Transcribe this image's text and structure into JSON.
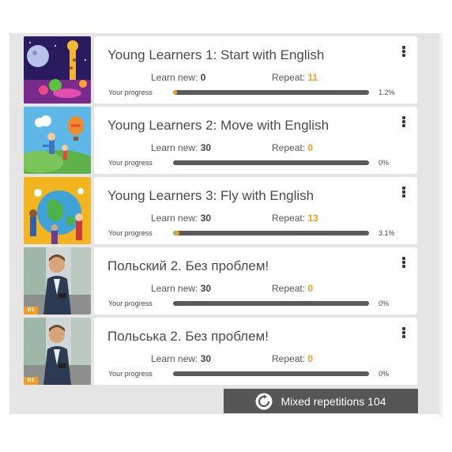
{
  "progress_label": "Your progress",
  "learn_new_label": "Learn new:",
  "repeat_label": "Repeat:",
  "courses": [
    {
      "title": "Young Learners 1: Start with English",
      "learn_new": "0",
      "repeat": "11",
      "progress_pct": "1.2%",
      "progress": 0.012,
      "thumb": "space-giraffe-illustration"
    },
    {
      "title": "Young Learners 2: Move with English",
      "learn_new": "30",
      "repeat": "0",
      "progress_pct": "0%",
      "progress": 0.0,
      "thumb": "balloon-field-illustration"
    },
    {
      "title": "Young Learners 3: Fly with English",
      "learn_new": "30",
      "repeat": "13",
      "progress_pct": "3.1%",
      "progress": 0.031,
      "thumb": "globe-people-illustration"
    },
    {
      "title": "Польский 2. Без проблем!",
      "learn_new": "30",
      "repeat": "0",
      "progress_pct": "0%",
      "progress": 0.0,
      "thumb": "businessman-photo",
      "badge": "B1"
    },
    {
      "title": "Польська 2. Без проблем!",
      "learn_new": "30",
      "repeat": "0",
      "progress_pct": "0%",
      "progress": 0.0,
      "thumb": "businessman-photo",
      "badge": "B1"
    }
  ],
  "mixed_button": {
    "label": "Mixed repetitions 104",
    "icon": "refresh-icon"
  },
  "colors": {
    "accent": "#f39c1f",
    "bar": "#5a5a5a",
    "button": "#565656",
    "panel": "#e5e5e5"
  }
}
